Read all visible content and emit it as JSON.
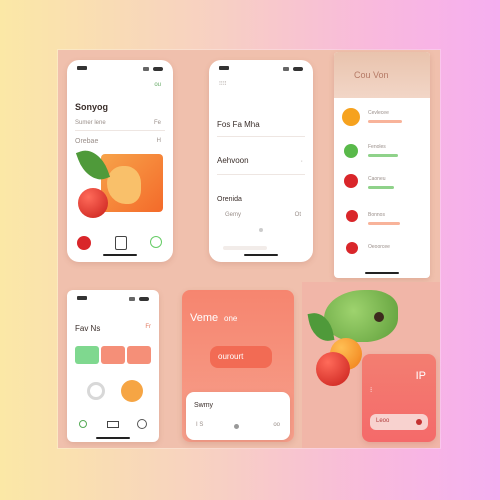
{
  "screens": {
    "s1": {
      "heading": "Sonyog",
      "badge": "ou",
      "row1_label": "Sumer lene",
      "row1_value": "Fe",
      "row2_label": "Orebae",
      "row2_value": "H"
    },
    "s2": {
      "item1": "Fos Fa Mha",
      "item2": "Aehvoon",
      "item3": "Orenida",
      "sub_left": "Gemy",
      "sub_right": "Ot"
    },
    "s3": {
      "title": "Cou Von",
      "items": [
        "Cevlecee",
        "Fenoles",
        "Caoneu",
        "Bonnos",
        "Oeoorcee"
      ]
    },
    "s4": {
      "title": "Fav Ns",
      "badge": "Fr"
    },
    "s5": {
      "title": "Veme",
      "badge": "one",
      "chip": "ourourt",
      "bottom_title": "Swmy",
      "bottom_left": "I S",
      "bottom_right": "oo"
    },
    "s6": {
      "big": "IP",
      "button": "Leoo"
    }
  },
  "colors": {
    "orange": "#f5832f",
    "tomato": "#e22b24",
    "green": "#6fcf8a",
    "salmon": "#f58f78"
  }
}
